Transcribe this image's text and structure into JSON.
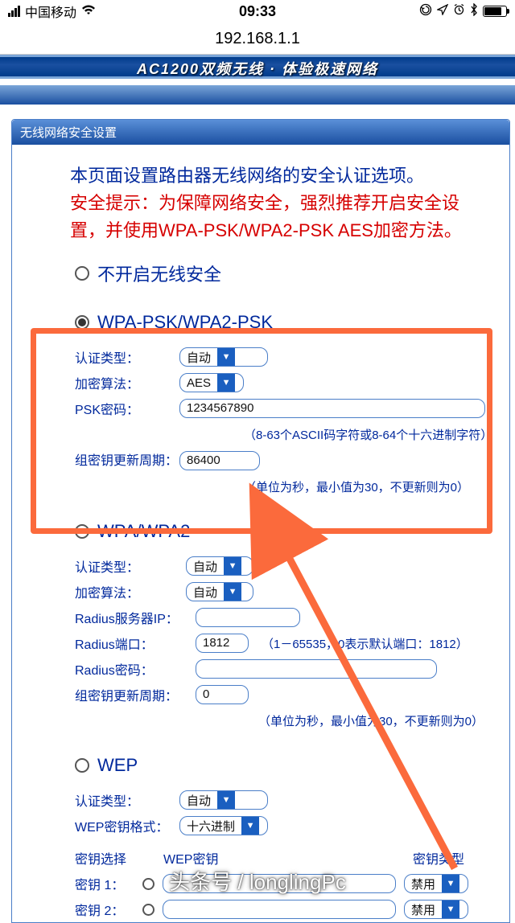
{
  "status": {
    "carrier": "中国移动",
    "time": "09:33"
  },
  "url": "192.168.1.1",
  "banner": "AC1200双频无线 · 体验极速网络",
  "panel_title": "无线网络安全设置",
  "intro": {
    "line1": "本页面设置路由器无线网络的安全认证选项。",
    "line2": "安全提示：为保障网络安全，强烈推荐开启安全设置，并使用WPA-PSK/WPA2-PSK AES加密方法。"
  },
  "opt_disable": "不开启无线安全",
  "wpapsk": {
    "title": "WPA-PSK/WPA2-PSK",
    "auth_label": "认证类型：",
    "auth_value": "自动",
    "enc_label": "加密算法：",
    "enc_value": "AES",
    "psk_label": "PSK密码：",
    "psk_value": "1234567890",
    "psk_hint": "（8-63个ASCII码字符或8-64个十六进制字符）",
    "gk_label": "组密钥更新周期：",
    "gk_value": "86400",
    "gk_hint": "（单位为秒，最小值为30，不更新则为0）"
  },
  "wpa": {
    "title": "WPA/WPA2",
    "auth_label": "认证类型：",
    "auth_value": "自动",
    "enc_label": "加密算法：",
    "enc_value": "自动",
    "radius_ip_label": "Radius服务器IP：",
    "radius_ip_value": "",
    "radius_port_label": "Radius端口：",
    "radius_port_value": "1812",
    "radius_port_hint": "（1－65535，0表示默认端口：1812）",
    "radius_pwd_label": "Radius密码：",
    "radius_pwd_value": "",
    "gk_label": "组密钥更新周期：",
    "gk_value": "0",
    "gk_hint": "（单位为秒，最小值为30，不更新则为0）"
  },
  "wep": {
    "title": "WEP",
    "auth_label": "认证类型：",
    "auth_value": "自动",
    "fmt_label": "WEP密钥格式：",
    "fmt_value": "十六进制",
    "col_select": "密钥选择",
    "col_key": "WEP密钥",
    "col_type": "密钥类型",
    "key1_label": "密钥 1：",
    "key2_label": "密钥 2：",
    "disable": "禁用"
  },
  "watermark": "头条号 / longlingPc"
}
